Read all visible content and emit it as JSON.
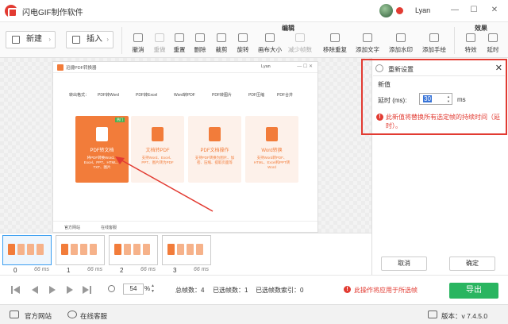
{
  "app": {
    "title": "闪电GIF制作软件",
    "username": "Lyan"
  },
  "window_controls": {
    "minimize": "—",
    "maximize": "☐",
    "close": "✕"
  },
  "toolbar": {
    "new_label": "新建",
    "insert_label": "插入",
    "edit_section": "编辑",
    "effect_section": "效果",
    "tools": [
      {
        "label": "撤消",
        "icon": "undo-icon"
      },
      {
        "label": "重做",
        "icon": "redo-icon"
      },
      {
        "label": "重置",
        "icon": "reset-icon"
      },
      {
        "label": "删除",
        "icon": "delete-icon"
      },
      {
        "label": "裁剪",
        "icon": "scissors-icon"
      },
      {
        "label": "旋转",
        "icon": "rotate-icon"
      },
      {
        "label": "画布大小",
        "icon": "canvas-size-icon"
      },
      {
        "label": "减少帧数",
        "icon": "reduce-frames-icon"
      },
      {
        "label": "移除重复",
        "icon": "remove-duplicates-icon"
      },
      {
        "label": "添加文字",
        "icon": "text-icon"
      },
      {
        "label": "添加水印",
        "icon": "watermark-icon"
      },
      {
        "label": "添加手绘",
        "icon": "pen-icon"
      },
      {
        "label": "特效",
        "icon": "effects-icon"
      },
      {
        "label": "延时",
        "icon": "delay-icon"
      }
    ]
  },
  "preview": {
    "app_title": "迅捷PDF转换器",
    "user": "Lyan",
    "top_links": [
      "转出格式：",
      "PDF转Word",
      "PDF转Excel",
      "Word转PDF",
      "PDF转图片",
      "PDF压缩",
      "PDF合并"
    ],
    "cards": [
      {
        "title": "PDF转文档",
        "desc": "将PDF转换Word、Excel、PPT、HTML、TXT、图片",
        "badge": "热门"
      },
      {
        "title": "文档转PDF",
        "desc": "支持Word、Excel、PPT、图片转为PDF"
      },
      {
        "title": "PDF文档操作",
        "desc": "支持PDF转换为图片、加密、压缩、提取页面等"
      },
      {
        "title": "Word转换",
        "desc": "支持Word转PDF、HTML、Excel和PPT转Word"
      }
    ],
    "bottom_links": [
      "官方网站",
      "在线客服"
    ]
  },
  "dialog": {
    "title": "重新设置",
    "close": "✕",
    "subtitle": "新值",
    "delay_label": "延时 (ms):",
    "delay_value": "30",
    "unit": "ms",
    "warning": "此新值将替换所有选定帧的持续时间（延时）。"
  },
  "panel_buttons": {
    "cancel": "取消",
    "ok": "确定"
  },
  "frames": [
    {
      "index": "0",
      "delay": "66 ms",
      "selected": true
    },
    {
      "index": "1",
      "delay": "66 ms",
      "selected": false
    },
    {
      "index": "2",
      "delay": "66 ms",
      "selected": false
    },
    {
      "index": "3",
      "delay": "66 ms",
      "selected": false
    }
  ],
  "controls": {
    "zoom": "54",
    "zoom_unit": "%",
    "total_frames": "总帧数：4",
    "selected_frames": "已选帧数：1",
    "selected_index": "已选帧数索引：0",
    "warning": "此操作将应用于所选帧",
    "export": "导出"
  },
  "footer": {
    "website": "官方网站",
    "support": "在线客服",
    "version": "版本：v 7.4.5.0"
  },
  "colors": {
    "accent_red": "#e23b32",
    "export_green": "#29b560",
    "card_orange": "#f27c3a",
    "selected_blue": "#3a9ef0"
  }
}
